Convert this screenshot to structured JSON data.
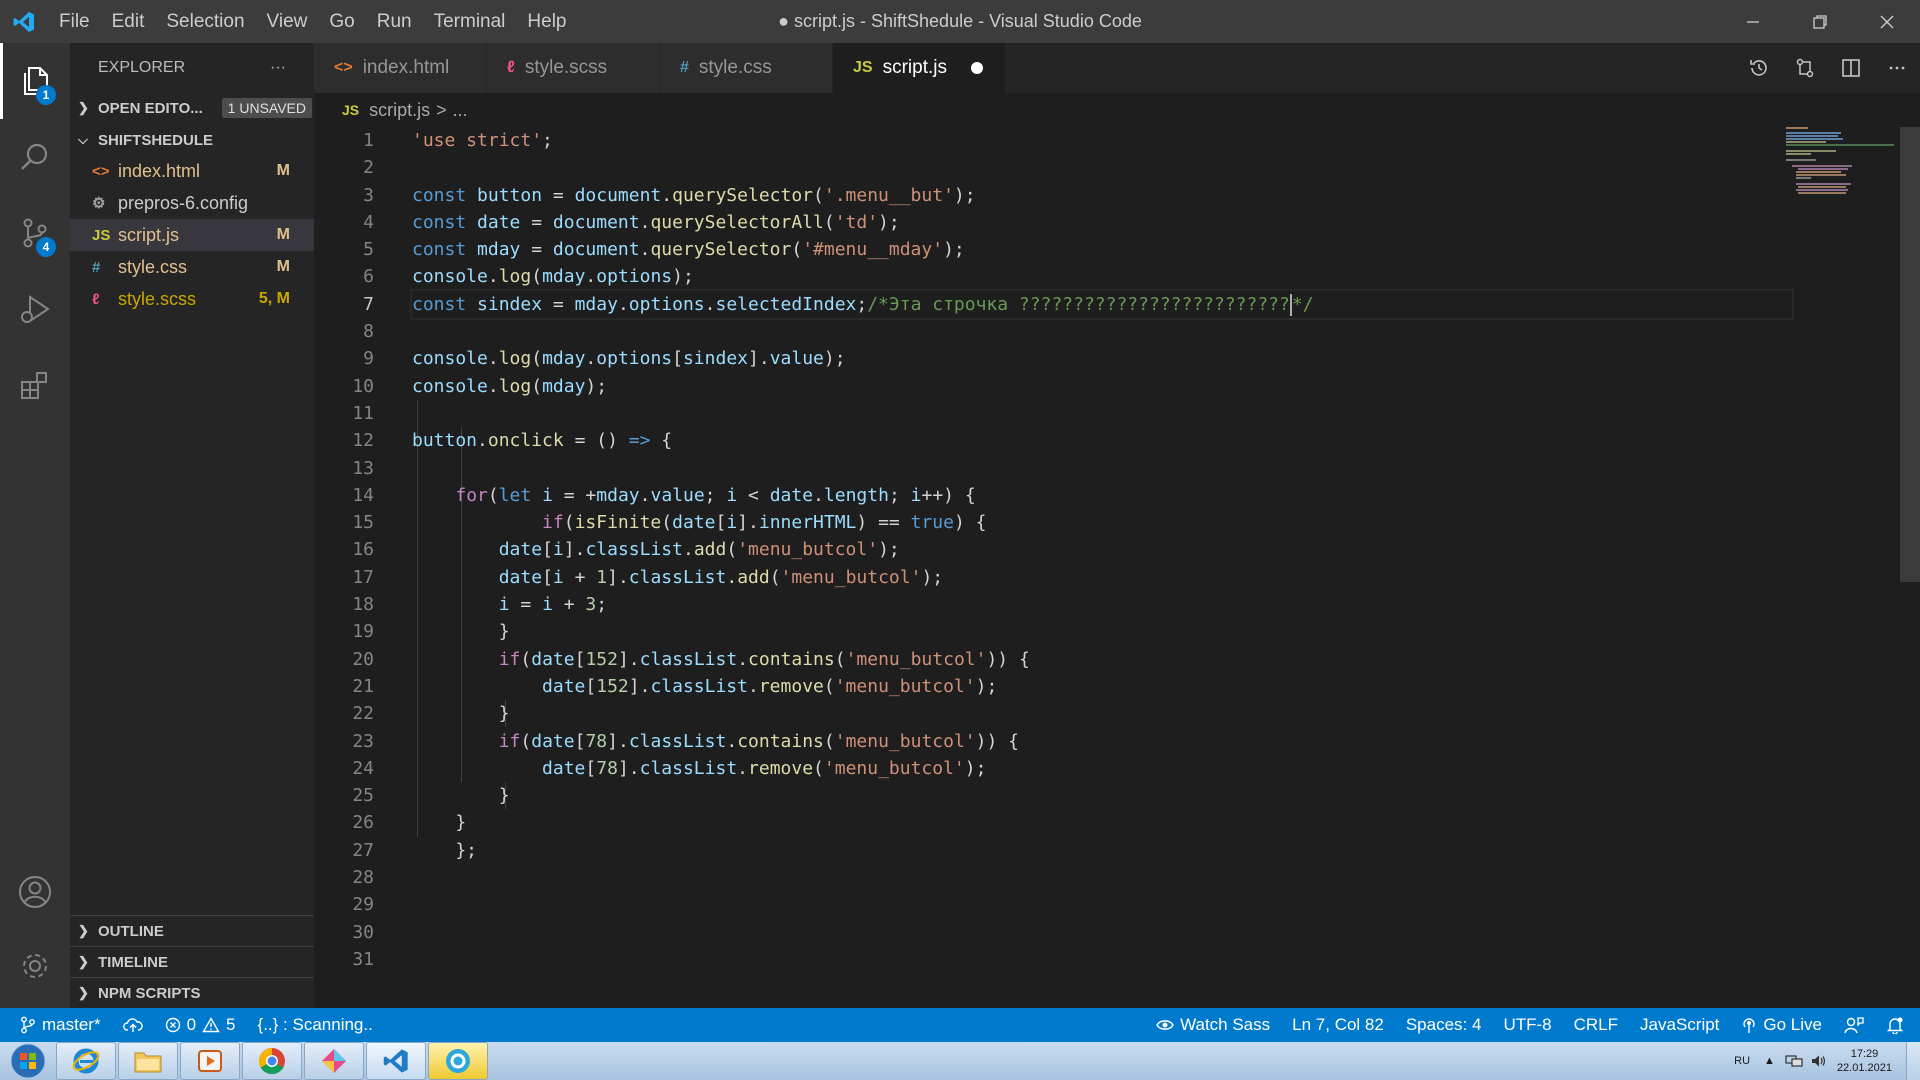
{
  "window": {
    "title": "● script.js - ShiftShedule - Visual Studio Code",
    "menu": [
      "File",
      "Edit",
      "Selection",
      "View",
      "Go",
      "Run",
      "Terminal",
      "Help"
    ]
  },
  "activity": {
    "explorer_badge": "1",
    "scm_badge": "4"
  },
  "sidebar": {
    "header": "EXPLORER",
    "more": "···",
    "open_editors": "OPEN EDITO...",
    "unsaved_badge": "1 UNSAVED",
    "project": "SHIFTSHEDULE",
    "files": [
      {
        "name": "index.html",
        "status": "M",
        "icon": "<>",
        "color": "#e2c08d",
        "iconColor": "#e37933"
      },
      {
        "name": "prepros-6.config",
        "status": "",
        "icon": "⚙",
        "color": "#cccccc",
        "iconColor": "#a0a0a0"
      },
      {
        "name": "script.js",
        "status": "M",
        "icon": "JS",
        "color": "#e2c08d",
        "iconColor": "#cbcb41"
      },
      {
        "name": "style.css",
        "status": "M",
        "icon": "#",
        "color": "#e2c08d",
        "iconColor": "#519aba"
      },
      {
        "name": "style.scss",
        "status": "5, M",
        "icon": "ℓ",
        "color": "#cca700",
        "iconColor": "#f55385"
      }
    ],
    "bottom": [
      "OUTLINE",
      "TIMELINE",
      "NPM SCRIPTS"
    ]
  },
  "tabs": [
    {
      "label": "index.html",
      "icon": "<>",
      "iconColor": "#e37933"
    },
    {
      "label": "style.scss",
      "icon": "ℓ",
      "iconColor": "#f55385"
    },
    {
      "label": "style.css",
      "icon": "#",
      "iconColor": "#519aba"
    },
    {
      "label": "script.js",
      "icon": "JS",
      "iconColor": "#cbcb41"
    }
  ],
  "breadcrumb": {
    "icon": "JS",
    "file": "script.js",
    "sep": ">",
    "rest": "..."
  },
  "editor": {
    "current_line": 7,
    "line_count": 31
  },
  "statusbar": {
    "branch": "master*",
    "errors": "0",
    "warnings": "5",
    "scanning": "{..} : Scanning..",
    "watch_sass": "Watch Sass",
    "position": "Ln 7, Col 82",
    "spaces": "Spaces: 4",
    "encoding": "UTF-8",
    "eol": "CRLF",
    "language": "JavaScript",
    "go_live": "Go Live"
  },
  "taskbar": {
    "lang": "RU",
    "time": "17:29",
    "date": "22.01.2021"
  }
}
